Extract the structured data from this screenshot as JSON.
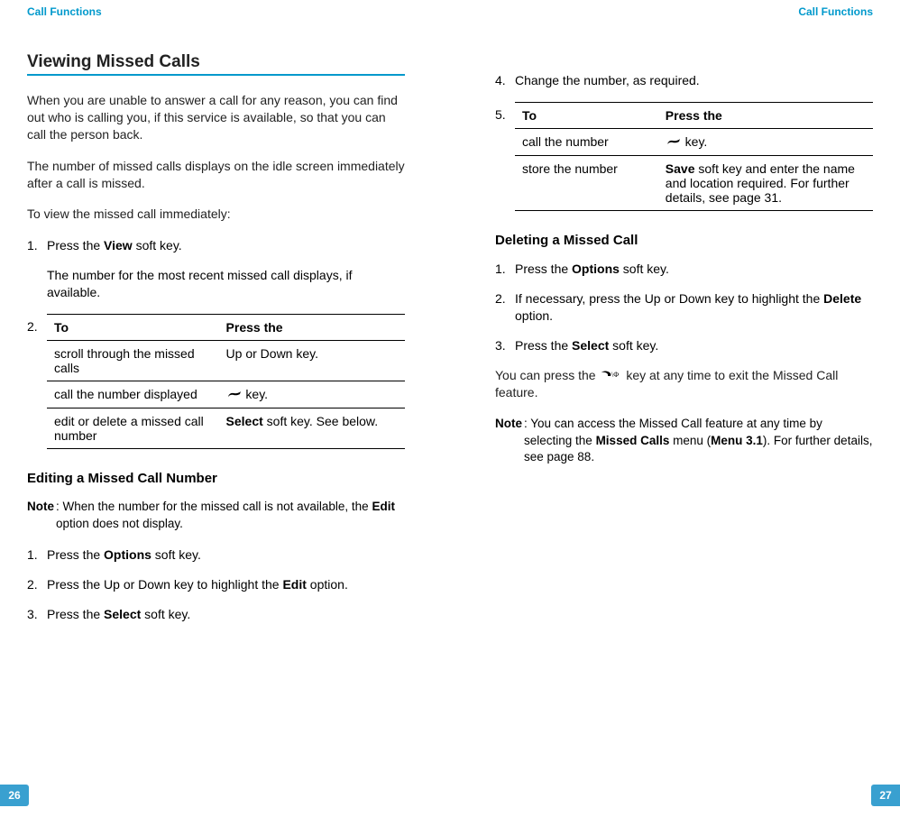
{
  "header": {
    "left_label": "Call Functions",
    "right_label": "Call Functions"
  },
  "page_left": {
    "number": "26",
    "section_title": "Viewing Missed Calls",
    "intro1": "When you are unable to answer a call for any reason, you can find out who is calling you, if this service is available, so that you can call the person back.",
    "intro2": "The number of missed calls displays on the idle screen immediately after a call is missed.",
    "intro3": "To view the missed call immediately:",
    "step1_num": "1.",
    "step1_text_a": "Press the ",
    "step1_text_bold": "View",
    "step1_text_b": " soft key.",
    "step1_sub": "The number for the most recent missed call displays, if available.",
    "table_num": "2.",
    "table_header_to": "To",
    "table_header_press": "Press the",
    "table_rows": [
      {
        "to": "scroll through the missed calls",
        "press": "Up or Down key."
      },
      {
        "to": "call the number displayed",
        "press_icon": true,
        "press": " key."
      },
      {
        "to": "edit or delete a missed call number",
        "press_bold": "Select",
        "press": " soft key. See below."
      }
    ],
    "subheading1": "Editing a Missed Call Number",
    "note1_label": "Note",
    "note1_text_a": ": When the number for the missed call is not available, the ",
    "note1_bold": "Edit",
    "note1_text_b": " option does not display.",
    "edit_step1_num": "1.",
    "edit_step1_a": "Press the ",
    "edit_step1_bold": "Options",
    "edit_step1_b": " soft key.",
    "edit_step2_num": "2.",
    "edit_step2_a": "Press the Up or Down key to highlight the ",
    "edit_step2_bold": "Edit",
    "edit_step2_b": " option.",
    "edit_step3_num": "3.",
    "edit_step3_a": "Press the ",
    "edit_step3_bold": "Select",
    "edit_step3_b": " soft key."
  },
  "page_right": {
    "number": "27",
    "step4_num": "4.",
    "step4_text": "Change the number, as required.",
    "table_num": "5.",
    "table_header_to": "To",
    "table_header_press": "Press the",
    "table_rows": [
      {
        "to": "call the number",
        "press_icon": true,
        "press": " key."
      },
      {
        "to": "store the number",
        "press_bold": "Save",
        "press": " soft key and enter the name and location required. For further details, see page 31."
      }
    ],
    "subheading1": "Deleting a Missed Call",
    "del_step1_num": "1.",
    "del_step1_a": "Press the ",
    "del_step1_bold": "Options",
    "del_step1_b": " soft key.",
    "del_step2_num": "2.",
    "del_step2_a": "If necessary, press the Up or Down key to highlight the ",
    "del_step2_bold": "Delete",
    "del_step2_b": " option.",
    "del_step3_num": "3.",
    "del_step3_a": "Press the ",
    "del_step3_bold": "Select",
    "del_step3_b": " soft key.",
    "para_exit_a": "You can press the ",
    "para_exit_b": " key at any time to exit the Missed Call feature.",
    "note1_label": "Note",
    "note1_text_a": ": You can access the Missed Call feature at any time by selecting the ",
    "note1_bold1": "Missed Calls",
    "note1_text_b": " menu (",
    "note1_bold2": "Menu 3.1",
    "note1_text_c": "). For further details, see page 88."
  }
}
